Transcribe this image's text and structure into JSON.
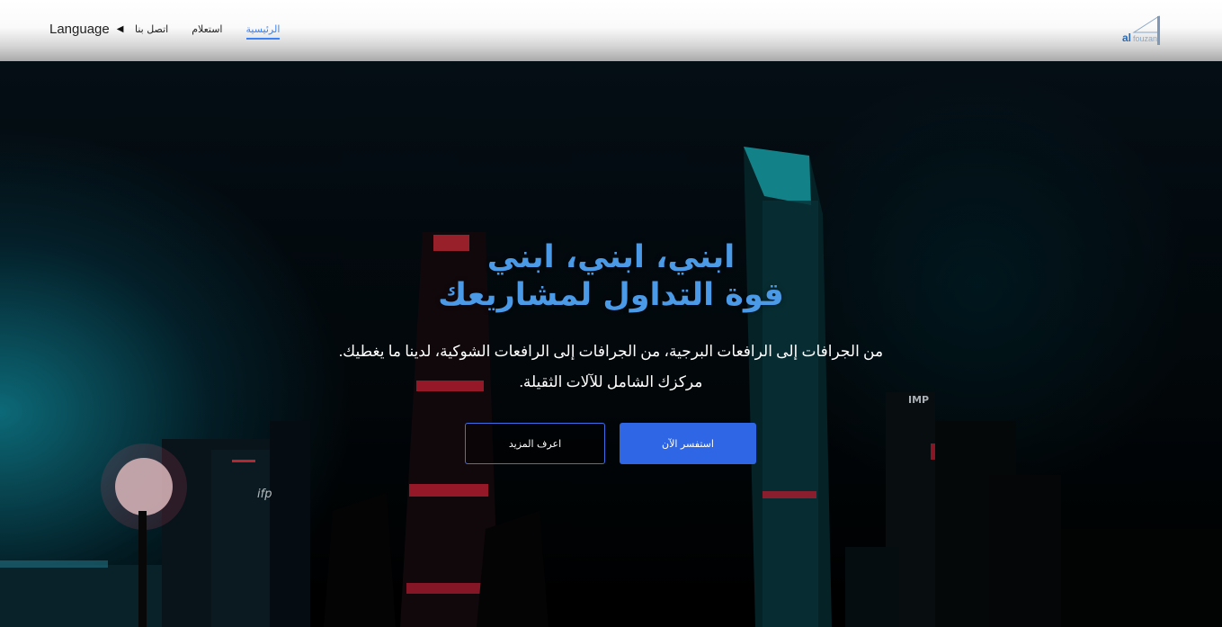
{
  "nav": {
    "language_label": "Language",
    "links": [
      "الرئيسية",
      "استعلام",
      "اتصل بنا"
    ],
    "logo_text": "alfouzan"
  },
  "hero": {
    "headline_line1": "ابني، ابني، ابني",
    "headline_line2": "قوة التداول لمشاريعك",
    "description_line1": "من الجرافات إلى الرافعات البرجية، من الجرافات إلى الرافعات الشوكية، لدينا ما يغطيك.",
    "description_line2": "مركزك الشامل للآلات الثقيلة.",
    "primary_button": "استفسر الآن",
    "secondary_button": "اعرف المزيد"
  },
  "colors": {
    "accent": "#2f66e6",
    "headline": "#4b9ae8",
    "active_link": "#3b82f6"
  }
}
